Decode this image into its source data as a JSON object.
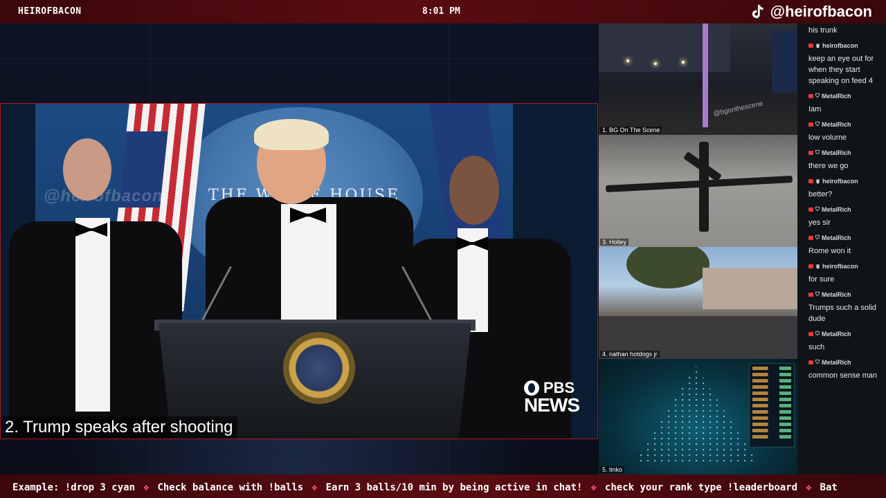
{
  "topbar": {
    "brand": "HEIROFBACON",
    "clock": "8:01 PM",
    "handle": "@heirofbacon"
  },
  "main_video": {
    "caption": "2. Trump speaks after shooting",
    "watermark": "@heirofbacon",
    "backdrop_text": "THE WHITE HOUSE",
    "network_line1": "PBS",
    "network_line2": "NEWS"
  },
  "feeds": [
    {
      "label": "1. BG On The Scene",
      "overlay": "@bgonthescene"
    },
    {
      "label": "3. Holley"
    },
    {
      "label": "4. nathan hotdogs jr"
    },
    {
      "label": "5. tinko"
    }
  ],
  "chat": {
    "top_fragment": "his trunk",
    "messages": [
      {
        "user": "heirofbacon",
        "icon": "crown-icon",
        "text": "keep an eye out for when they start speaking on feed 4"
      },
      {
        "user": "MetalRich",
        "icon": "shield-icon",
        "text": "Iam"
      },
      {
        "user": "MetalRich",
        "icon": "shield-icon",
        "text": "low volume"
      },
      {
        "user": "MetalRich",
        "icon": "shield-icon",
        "text": "there we go"
      },
      {
        "user": "heirofbacon",
        "icon": "crown-icon",
        "text": "better?"
      },
      {
        "user": "MetalRich",
        "icon": "shield-icon",
        "text": "yes sir"
      },
      {
        "user": "MetalRich",
        "icon": "shield-icon",
        "text": "Rome won it"
      },
      {
        "user": "heirofbacon",
        "icon": "crown-icon",
        "text": "for sure"
      },
      {
        "user": "MetalRich",
        "icon": "shield-icon",
        "text": "Trumps such a solid dude"
      },
      {
        "user": "MetalRich",
        "icon": "shield-icon",
        "text": "such"
      },
      {
        "user": "MetalRich",
        "icon": "shield-icon",
        "text": "common sense man"
      }
    ]
  },
  "ticker": {
    "items": [
      "Example: !drop 3 cyan",
      "Check balance with !balls",
      "Earn 3 balls/10 min by being active in chat!",
      "check your rank type !leaderboard",
      "Bat"
    ]
  },
  "colors": {
    "accent": "#5a0c12",
    "border_live": "#b0121c",
    "ticker_separator": "#ff5470"
  }
}
